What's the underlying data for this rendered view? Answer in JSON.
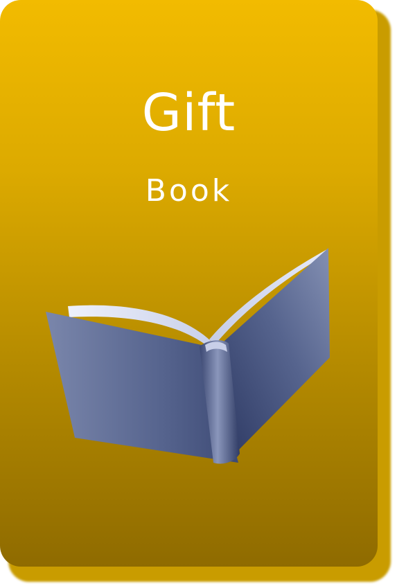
{
  "card": {
    "title": "Gift",
    "subtitle": "Book",
    "icon": "open-book-icon",
    "colors": {
      "card_top": "#f2bb00",
      "card_bottom": "#8f6b00",
      "shadow": "#c99c00",
      "text": "#ffffff",
      "book_cover": "#5c6a91",
      "book_pages": "#dde2f4"
    }
  }
}
